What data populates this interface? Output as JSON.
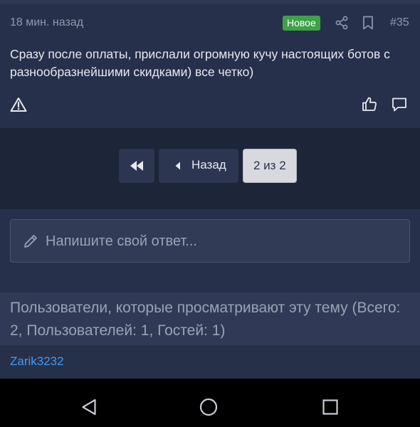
{
  "post": {
    "time": "18 мин. назад",
    "badge": "Новое",
    "number": "#35",
    "text": "Сразу после оплаты, прислали огромную кучу настоящих ботов с разнообразнейшими скидками) все четко)",
    "icons": [
      "share-icon",
      "bookmark-icon",
      "warning-icon",
      "like-icon",
      "reply-icon"
    ]
  },
  "pagination": {
    "back_label": "Назад",
    "current_label": "2 из 2",
    "icons": [
      "first-page-icon",
      "prev-arrow-icon"
    ]
  },
  "reply": {
    "placeholder": "Напишите свой ответ..."
  },
  "viewers": {
    "title": "Пользователи, которые просматривают эту тему (Всего: 2, Пользователей: 1, Гостей: 1)",
    "users": [
      "Zarik3232"
    ]
  },
  "nav": {
    "icons": [
      "back-triangle-icon",
      "home-circle-icon",
      "recents-square-icon"
    ]
  },
  "colors": {
    "background": "#1c2433",
    "panel": "#27304a",
    "badge_green": "#3fa148",
    "link_blue": "#3d9bf5",
    "muted_text": "#8f98ad"
  }
}
